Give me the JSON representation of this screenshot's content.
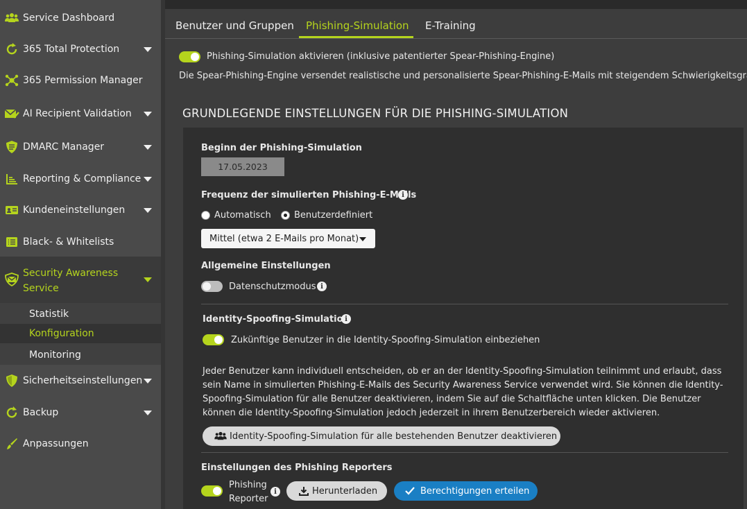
{
  "sidebar": {
    "items": [
      {
        "label": "Service Dashboard",
        "icon": "users-icon"
      },
      {
        "label": "365 Total Protection",
        "icon": "refresh-circle-icon"
      },
      {
        "label": "365 Permission Manager",
        "icon": "network-icon"
      },
      {
        "label": "AI Recipient Validation",
        "icon": "mail-check-icon"
      },
      {
        "label": "DMARC Manager",
        "icon": "shield-list-icon"
      },
      {
        "label": "Reporting & Compliance",
        "icon": "chart-icon"
      },
      {
        "label": "Kundeneinstellungen",
        "icon": "id-card-icon"
      },
      {
        "label": "Black- & Whitelists",
        "icon": "list-icon"
      },
      {
        "label": "Security Awareness Service",
        "icon": "shield-mail-icon"
      },
      {
        "label": "Sicherheitseinstellungen",
        "icon": "shield-icon"
      },
      {
        "label": "Backup",
        "icon": "refresh-icon"
      },
      {
        "label": "Anpassungen",
        "icon": "brush-icon"
      }
    ],
    "subitems": [
      {
        "label": "Statistik"
      },
      {
        "label": "Konfiguration"
      },
      {
        "label": "Monitoring"
      }
    ]
  },
  "tabs": [
    {
      "label": "Benutzer und Gruppen"
    },
    {
      "label": "Phishing-Simulation"
    },
    {
      "label": "E-Training"
    }
  ],
  "activate_label": "Phishing-Simulation aktivieren (inklusive patentierter Spear-Phishing-Engine)",
  "description": "Die Spear-Phishing-Engine versendet realistische und personalisierte Spear-Phishing-E-Mails mit steigendem Schwierigkeitsgrad.",
  "section_title": "GRUNDLEGENDE EINSTELLUNGEN FÜR DIE PHISHING-SIMULATION",
  "start": {
    "label": "Beginn der Phishing-Simulation",
    "value": "17.05.2023"
  },
  "frequency": {
    "label": "Frequenz der simulierten Phishing-E-Mails",
    "option_auto": "Automatisch",
    "option_custom": "Benutzerdefiniert",
    "selected": "Mittel (etwa 2 E-Mails pro Monat)"
  },
  "general": {
    "label": "Allgemeine Einstellungen",
    "privacy_label": "Datenschutzmodus"
  },
  "identity": {
    "label": "Identity-Spoofing-Simulation",
    "toggle_label": "Zukünftige Benutzer in die Identity-Spoofing-Simulation einbeziehen",
    "paragraph": "Jeder Benutzer kann individuell entscheiden, ob er an der Identity-Spoofing-Simulation teilnimmt und erlaubt, dass sein Name in simulierten Phishing-E-Mails des Security Awareness Service verwendet wird. Sie können die Identity-Spoofing-Simulation für alle Benutzer deaktivieren, indem Sie auf die Schaltfläche unten klicken. Die Benutzer können die Identity-Spoofing-Simulation jedoch jederzeit in ihrem Benutzerbereich wieder aktivieren.",
    "button": "Identity-Spoofing-Simulation für alle bestehenden Benutzer deaktivieren"
  },
  "reporter": {
    "label": "Einstellungen des Phishing Reporters",
    "toggle_line1": "Phishing",
    "toggle_line2": "Reporter",
    "download": "Herunterladen",
    "grant": "Berechtigungen erteilen"
  },
  "colors": {
    "accent": "#b5d41d",
    "blue": "#1a7fc4",
    "sidebar": "#4a4a4a",
    "panel": "#2f2f2f"
  }
}
